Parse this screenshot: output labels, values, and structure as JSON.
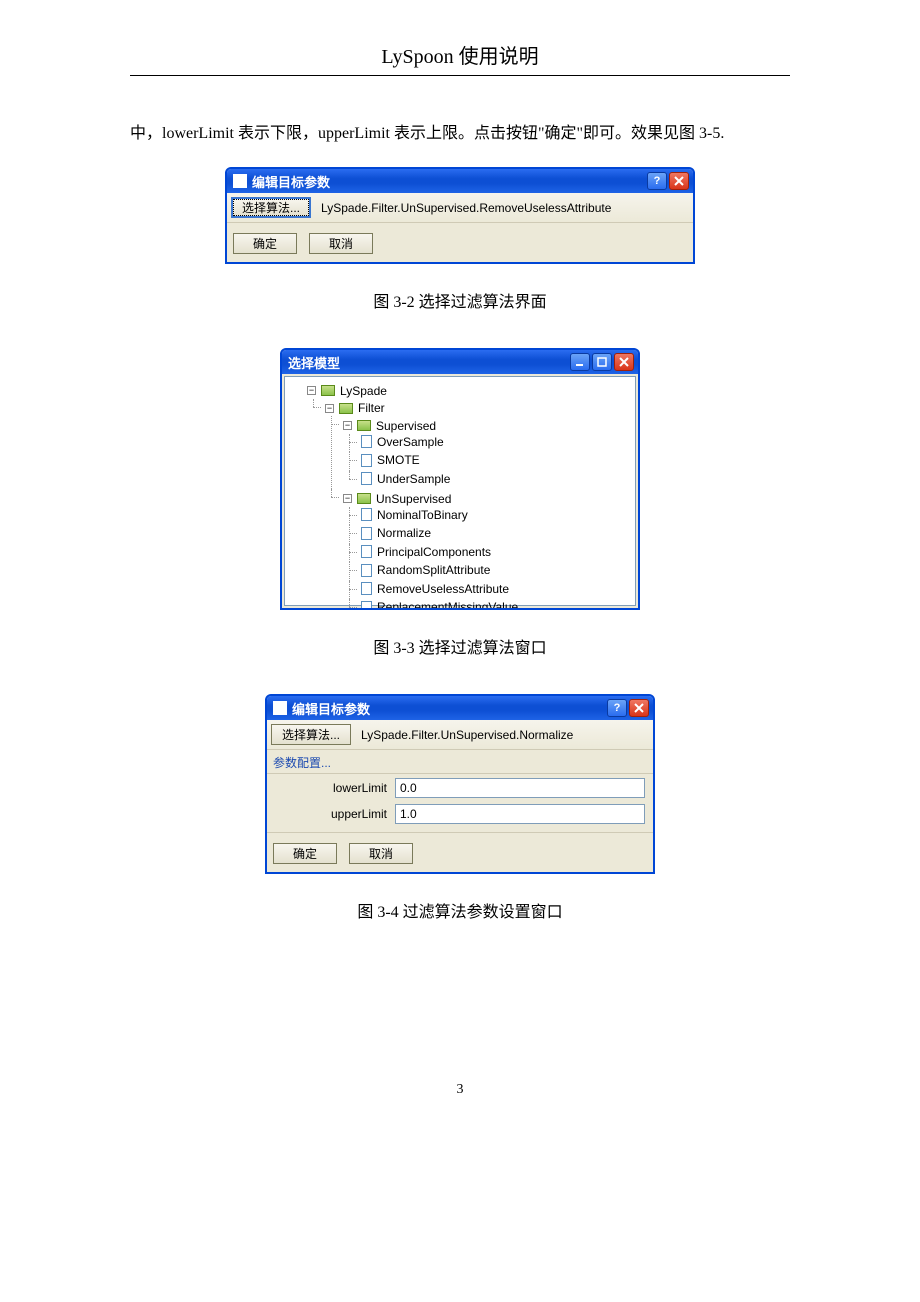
{
  "doc": {
    "header": "LySpoon 使用说明",
    "paragraph": "中，lowerLimit 表示下限，upperLimit 表示上限。点击按钮\"确定\"即可。效果见图 3-5.",
    "page_number": "3"
  },
  "fig32": {
    "caption": "图 3-2   选择过滤算法界面",
    "title": "编辑目标参数",
    "select_button": "选择算法...",
    "algorithm": "LySpade.Filter.UnSupervised.RemoveUselessAttribute",
    "ok": "确定",
    "cancel": "取消"
  },
  "fig33": {
    "caption": "图 3-3   选择过滤算法窗口",
    "title": "选择模型",
    "root": "LySpade",
    "n_filter": "Filter",
    "n_supervised": "Supervised",
    "leaf_oversample": "OverSample",
    "leaf_smote": "SMOTE",
    "leaf_undersample": "UnderSample",
    "n_unsupervised": "UnSupervised",
    "leaf_ntb": "NominalToBinary",
    "leaf_norm": "Normalize",
    "leaf_pca": "PrincipalComponents",
    "leaf_rsa": "RandomSplitAttribute",
    "leaf_rua": "RemoveUselessAttribute",
    "leaf_rmv": "ReplacementMissingValue"
  },
  "fig34": {
    "caption": "图 3-4   过滤算法参数设置窗口",
    "title": "编辑目标参数",
    "select_button": "选择算法...",
    "algorithm": "LySpade.Filter.UnSupervised.Normalize",
    "section": "参数配置...",
    "p1_label": "lowerLimit",
    "p1_value": "0.0",
    "p2_label": "upperLimit",
    "p2_value": "1.0",
    "ok": "确定",
    "cancel": "取消"
  }
}
